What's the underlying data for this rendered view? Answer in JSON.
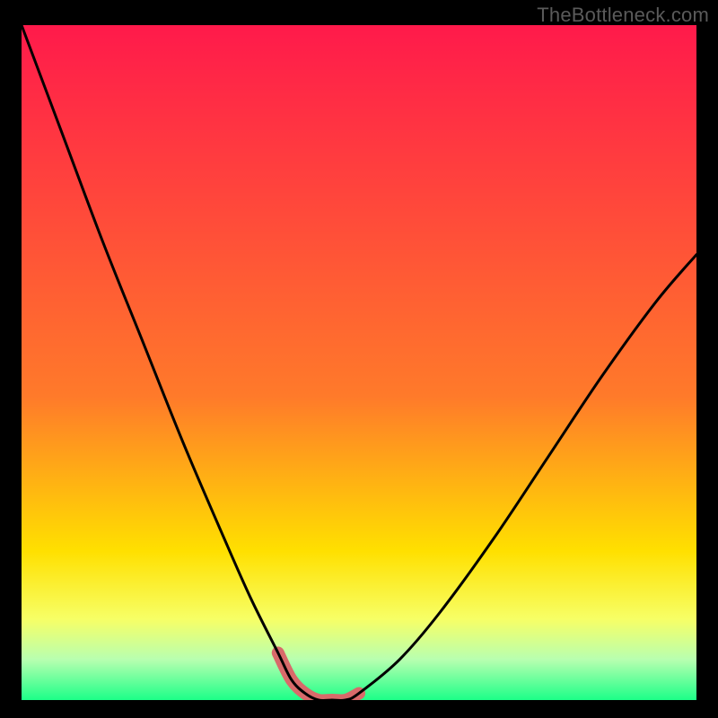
{
  "watermark": "TheBottleneck.com",
  "colors": {
    "frame": "#000000",
    "watermark": "#5a5a5a",
    "curve": "#000000",
    "highlight": "#d86a6a",
    "gradient_top": "#ff1a4b",
    "gradient_mid1": "#ff7a2a",
    "gradient_mid2": "#ffe000",
    "gradient_low1": "#f7ff66",
    "gradient_low2": "#b8ffb0",
    "gradient_bottom": "#1cff88"
  },
  "chart_data": {
    "type": "line",
    "title": "",
    "xlabel": "",
    "ylabel": "",
    "xlim": [
      0,
      100
    ],
    "ylim": [
      0,
      100
    ],
    "x": [
      0,
      6,
      12,
      18,
      24,
      30,
      34,
      38,
      40,
      42,
      44,
      46,
      48,
      50,
      56,
      62,
      70,
      78,
      86,
      94,
      100
    ],
    "values": [
      100,
      84,
      68,
      53,
      38,
      24,
      15,
      7,
      3,
      1,
      0,
      0,
      0,
      1,
      6,
      13,
      24,
      36,
      48,
      59,
      66
    ],
    "highlight_region": {
      "x0": 38,
      "x1": 50,
      "y_max": 9
    }
  }
}
